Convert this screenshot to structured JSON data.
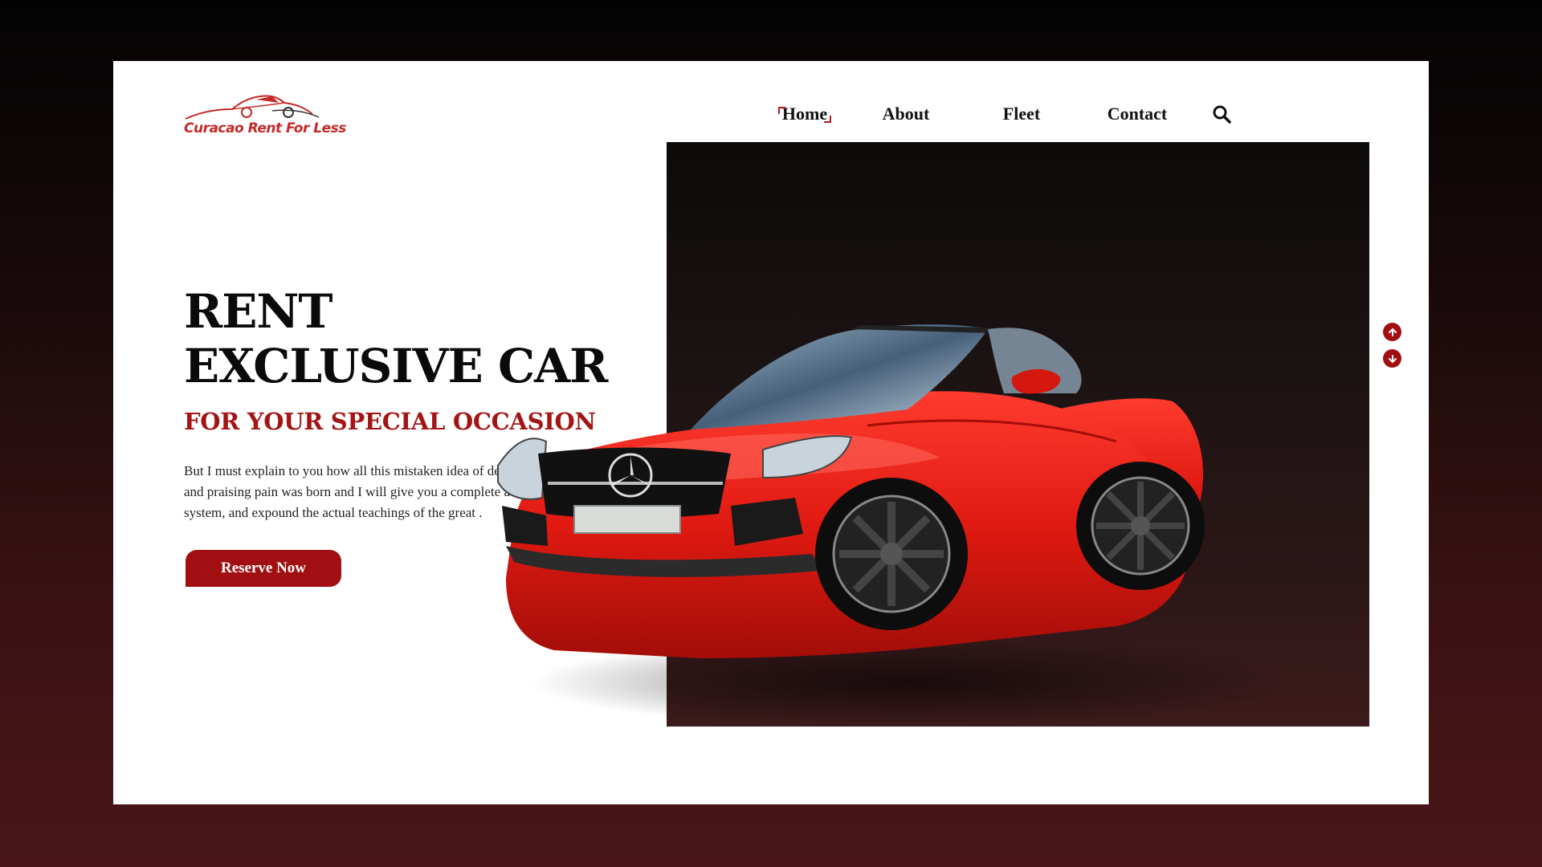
{
  "brand": {
    "logo_text": "Curacao Rent For Less",
    "color": "#c62828"
  },
  "nav": {
    "items": [
      {
        "label": "Home",
        "active": true
      },
      {
        "label": "About"
      },
      {
        "label": "Fleet"
      },
      {
        "label": "Contact"
      }
    ],
    "search_icon": "search-icon"
  },
  "hero": {
    "title_line1": "RENT",
    "title_line2": "EXCLUSIVE CAR",
    "subtitle": "FOR YOUR SPECIAL OCCASION",
    "body": "But I must explain to you how all this mistaken idea of denouncing pleasure and praising pain was born and I will give you a complete account of the system, and expound the actual teachings of the great .",
    "cta_label": "Reserve Now"
  },
  "slider": {
    "up_icon": "arrow-up-icon",
    "down_icon": "arrow-down-icon"
  },
  "colors": {
    "accent": "#a10f12",
    "car": "#e01a12"
  }
}
